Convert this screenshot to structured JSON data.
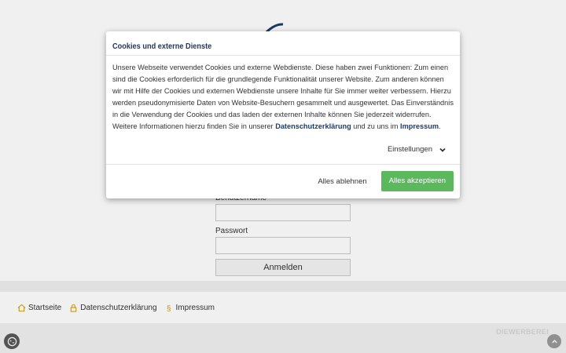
{
  "login": {
    "username_label": "Benutzername",
    "password_label": "Passwort",
    "submit_label": "Anmelden"
  },
  "footer": {
    "items": [
      {
        "label": "Startseite",
        "icon": "home-icon"
      },
      {
        "label": "Datenschutzerklärung",
        "icon": "lock-icon"
      },
      {
        "label": "Impressum",
        "icon": "paragraph-icon"
      }
    ],
    "brand": "DIEWERBEREI"
  },
  "modal": {
    "title": "Cookies und externe Dienste",
    "body_text": "Unsere Webseite verwendet Cookies und externe Webdienste. Diese haben zwei Funktionen: Zum einen sind die Cookies erforderlich für die grundlegende Funktionalität unserer Website. Zum anderen können wir mit Hilfe der Cookies und externen Webdienste unsere Inhalte für Sie immer weiter verbessern. Hierzu werden pseudonymisierte Daten von Website-Besuchern gesammelt und ausgewertet. Das Einverständnis in die Verwendung der Cookies und das laden der externen Inhalte können Sie jederzeit widerrufen. Weitere Informationen hierzu finden Sie in unserer",
    "privacy_link": "Datenschutzerklärung",
    "and_text": "und zu uns im",
    "imprint_link": "Impressum",
    "period": ".",
    "settings_label": "Einstellungen",
    "decline_label": "Alles ablehnen",
    "accept_label": "Alles akzeptieren"
  },
  "colors": {
    "accent_green": "#5cb85c",
    "link_navy": "#1a3c6e",
    "title_navy": "#22385a"
  }
}
